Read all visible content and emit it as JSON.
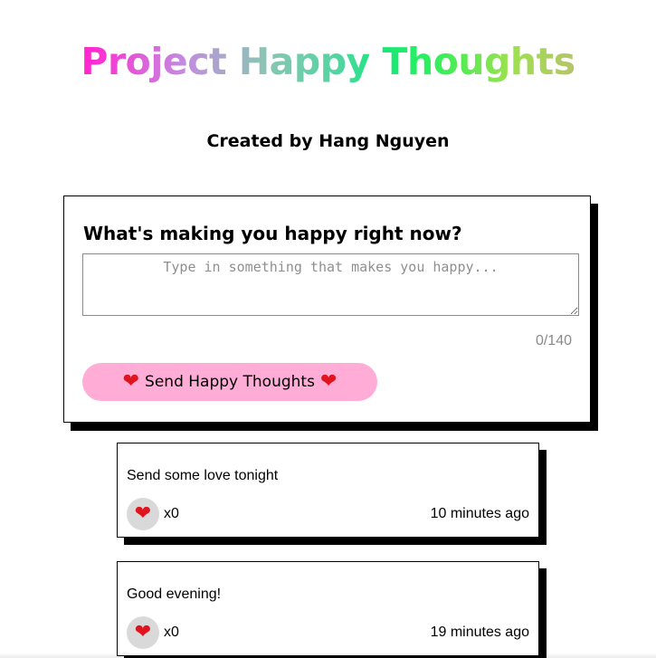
{
  "header": {
    "title": "Project Happy Thoughts",
    "subtitle": "Created by Hang Nguyen"
  },
  "form": {
    "heading": "What's making you happy right now?",
    "textarea_value": "",
    "textarea_placeholder": "Type in something that makes you happy...",
    "char_count": "0/140",
    "send_label": "Send Happy Thoughts",
    "send_icon": "heart-icon"
  },
  "colors": {
    "button_background": "#ffadd6",
    "heart": "#e0141e",
    "like_button_background": "#d9d9d9",
    "counter_text": "#8a8a8a"
  },
  "thoughts": [
    {
      "message": "Send some love tonight",
      "like_count": "x0",
      "time": "10 minutes ago"
    },
    {
      "message": "Good evening!",
      "like_count": "x0",
      "time": "19 minutes ago"
    }
  ]
}
